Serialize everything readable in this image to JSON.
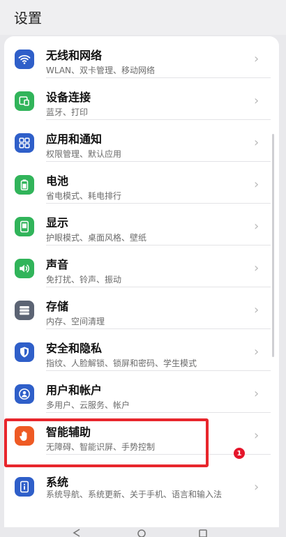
{
  "header": {
    "title": "设置"
  },
  "items": [
    {
      "label": "无线和网络",
      "sub": "WLAN、双卡管理、移动网络",
      "icon": "wifi-icon",
      "color": "#2f5fc9"
    },
    {
      "label": "设备连接",
      "sub": "蓝牙、打印",
      "icon": "device-connect-icon",
      "color": "#31b45a"
    },
    {
      "label": "应用和通知",
      "sub": "权限管理、默认应用",
      "icon": "apps-icon",
      "color": "#2f5fc9"
    },
    {
      "label": "电池",
      "sub": "省电模式、耗电排行",
      "icon": "battery-icon",
      "color": "#31b45a"
    },
    {
      "label": "显示",
      "sub": "护眼模式、桌面风格、壁纸",
      "icon": "display-icon",
      "color": "#31b45a"
    },
    {
      "label": "声音",
      "sub": "免打扰、铃声、振动",
      "icon": "sound-icon",
      "color": "#31b45a"
    },
    {
      "label": "存储",
      "sub": "内存、空间清理",
      "icon": "storage-icon",
      "color": "#5c6474"
    },
    {
      "label": "安全和隐私",
      "sub": "指纹、人脸解锁、锁屏和密码、学生模式",
      "icon": "shield-icon",
      "color": "#2f5fc9"
    },
    {
      "label": "用户和帐户",
      "sub": "多用户、云服务、帐户",
      "icon": "user-icon",
      "color": "#2f5fc9"
    },
    {
      "label": "智能辅助",
      "sub": "无障碍、智能识屏、手势控制",
      "icon": "hand-icon",
      "color": "#ee5a24"
    },
    {
      "label": "系统",
      "sub": "系统导航、系统更新、关于手机、语言和输入法",
      "icon": "system-icon",
      "color": "#2f5fc9",
      "badge": "1"
    }
  ]
}
